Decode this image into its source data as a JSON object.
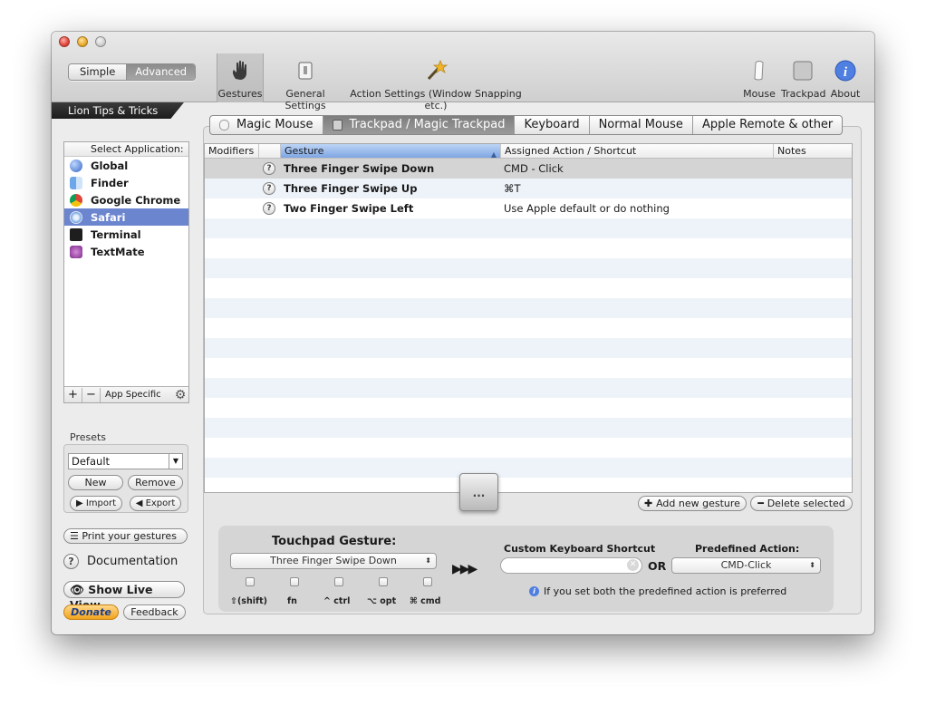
{
  "toolbar": {
    "mode_simple": "Simple",
    "mode_advanced": "Advanced",
    "items": [
      {
        "label": "Gestures",
        "icon": "hand-icon"
      },
      {
        "label": "General Settings",
        "icon": "switch-icon"
      },
      {
        "label": "Action Settings (Window Snapping etc.)",
        "icon": "magic-wand-icon"
      },
      {
        "label": "Mouse",
        "icon": "mouse-icon"
      },
      {
        "label": "Trackpad",
        "icon": "trackpad-icon"
      },
      {
        "label": "About",
        "icon": "info-icon"
      }
    ]
  },
  "sidebar": {
    "lion_tips": "Lion Tips & Tricks",
    "apps_header": "Select Application:",
    "apps": [
      {
        "name": "Global",
        "icon": "globe-icon"
      },
      {
        "name": "Finder",
        "icon": "finder-icon"
      },
      {
        "name": "Google Chrome",
        "icon": "chrome-icon"
      },
      {
        "name": "Safari",
        "icon": "safari-icon"
      },
      {
        "name": "Terminal",
        "icon": "terminal-icon"
      },
      {
        "name": "TextMate",
        "icon": "textmate-icon"
      }
    ],
    "selected_app": "Safari",
    "add": "+",
    "remove": "−",
    "app_specific": "App Specific",
    "presets_label": "Presets",
    "preset_value": "Default",
    "new": "New",
    "remove_preset": "Remove",
    "import": "Import",
    "export": "Export",
    "print": "Print your gestures",
    "documentation": "Documentation",
    "live_view": "Show Live View",
    "donate": "Donate",
    "feedback": "Feedback"
  },
  "tabs": [
    "Magic Mouse",
    "Trackpad / Magic Trackpad",
    "Keyboard",
    "Normal Mouse",
    "Apple Remote & other"
  ],
  "active_tab": "Trackpad / Magic Trackpad",
  "table": {
    "columns": [
      "Modifiers",
      "Gesture",
      "Assigned Action / Shortcut",
      "Notes"
    ],
    "rows": [
      {
        "gesture": "Three Finger Swipe Down",
        "action": "CMD - Click"
      },
      {
        "gesture": "Three Finger Swipe Up",
        "action": "⌘T"
      },
      {
        "gesture": "Two Finger Swipe Left",
        "action": "Use Apple default or do nothing"
      }
    ]
  },
  "more_button": "...",
  "add_gesture": "Add new gesture",
  "delete_selected": "Delete selected",
  "editor": {
    "touchpad_gesture_label": "Touchpad Gesture:",
    "gesture_value": "Three Finger Swipe Down",
    "modifiers": [
      "⇧(shift)",
      "fn",
      "^ ctrl",
      "⌥ opt",
      "⌘ cmd"
    ],
    "arrows": "▶▶▶",
    "custom_shortcut_label": "Custom Keyboard Shortcut",
    "or": "OR",
    "predefined_label": "Predefined Action:",
    "predefined_value": "CMD-Click",
    "info": "If you set both the predefined action is preferred"
  }
}
